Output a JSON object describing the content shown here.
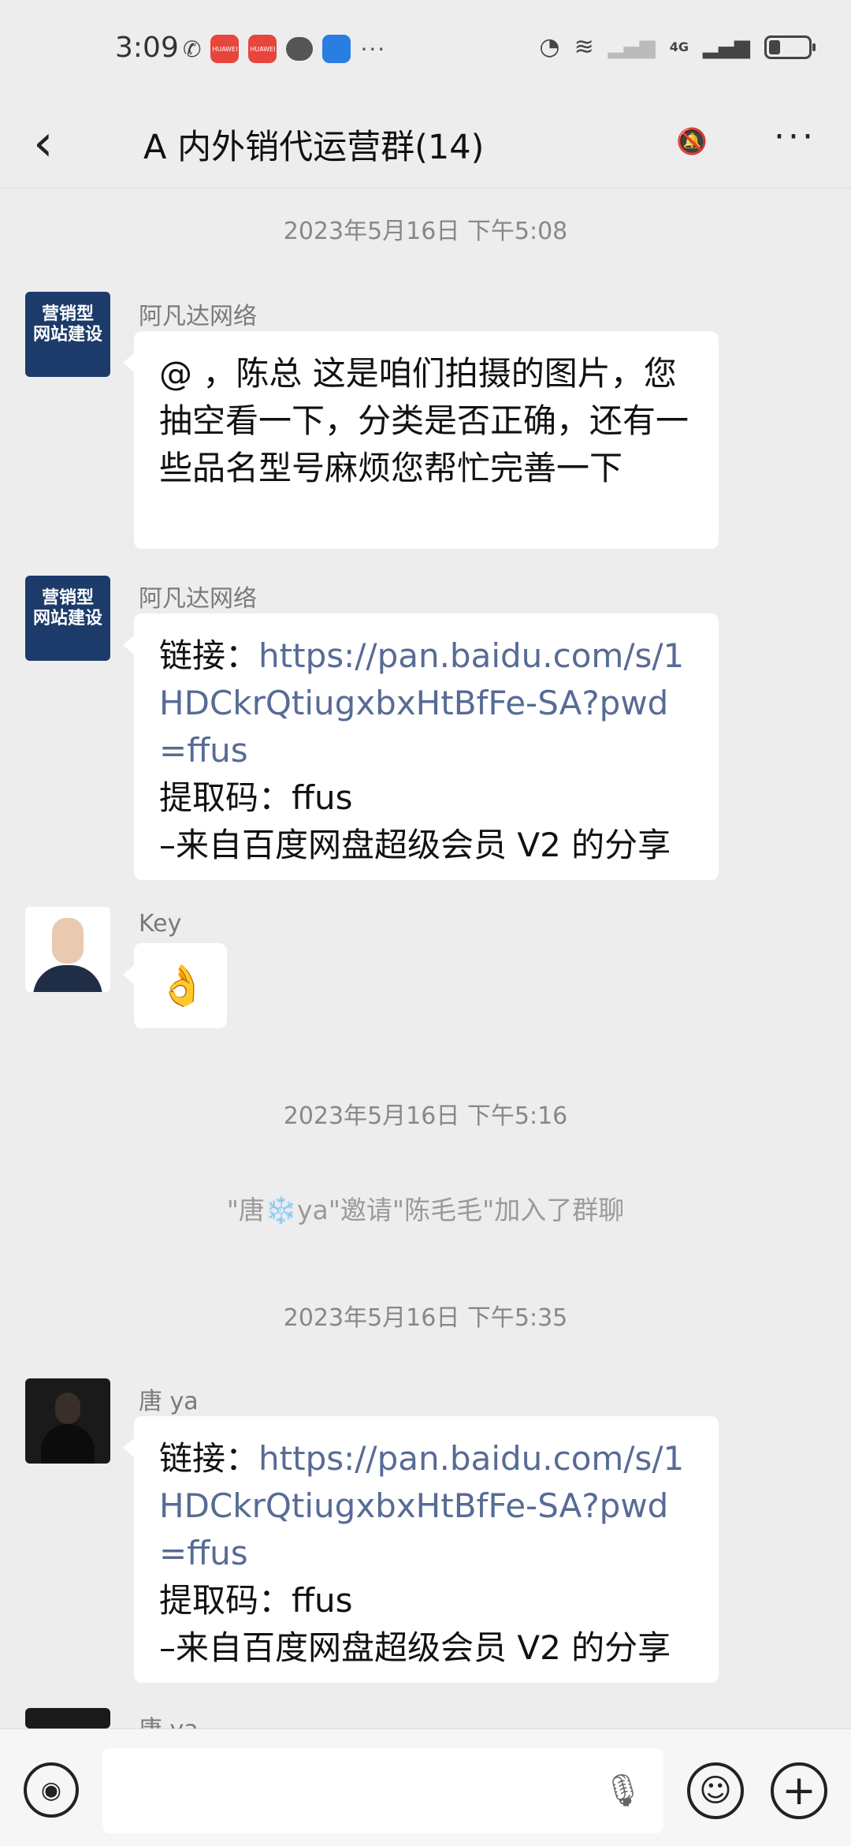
{
  "status_bar": {
    "time": "3:09",
    "app_badge_1": "HUAWEI",
    "app_badge_2": "HUAWEI",
    "network": "4G",
    "overflow": "···"
  },
  "header": {
    "back": "‹",
    "title": "A  内外销代运营群(14)",
    "mute_icon": "🔕",
    "more": "···"
  },
  "chat": {
    "ts1": "2023年5月16日 下午5:08",
    "m1": {
      "sender": "阿凡达网络",
      "avatar_line1": "营销型",
      "avatar_line2": "网站建设",
      "text": "@  ，陈总 这是咱们拍摄的图片，您抽空看一下，分类是否正确，还有一些品名型号麻烦您帮忙完善一下"
    },
    "m2": {
      "sender": "阿凡达网络",
      "avatar_line1": "营销型",
      "avatar_line2": "网站建设",
      "link_label": "链接：",
      "link": "https://pan.baidu.com/s/1HDCkrQtiugxbxHtBfFe-SA?pwd=ffus",
      "code_label": "提取码：",
      "code": "ffus",
      "footer": "–来自百度网盘超级会员 V2 的分享"
    },
    "m3": {
      "sender": "Key",
      "emoji": "👌"
    },
    "ts2": "2023年5月16日 下午5:16",
    "sys1": "\"唐❄️ya\"邀请\"陈毛毛\"加入了群聊",
    "ts3": "2023年5月16日 下午5:35",
    "m4": {
      "sender": "唐  ya",
      "link_label": "链接：",
      "link": "https://pan.baidu.com/s/1HDCkrQtiugxbxHtBfFe-SA?pwd=ffus",
      "code_label": "提取码：",
      "code": "ffus",
      "footer": "–来自百度网盘超级会员 V2 的分享"
    },
    "m5": {
      "sender": "唐  ya"
    }
  },
  "input_bar": {
    "voice_icon": "voice-icon",
    "mic_icon": "microphone-icon",
    "emoji_icon": "emoji-icon",
    "plus_icon": "plus-icon"
  }
}
